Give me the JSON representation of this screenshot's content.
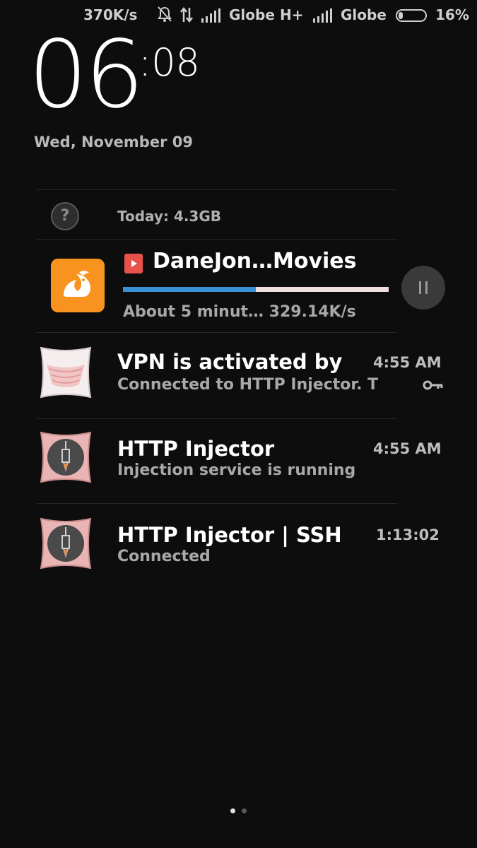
{
  "status_bar": {
    "speed": "370K/s",
    "carrier1_network": "",
    "carrier1": "Globe",
    "network_type": "H+",
    "carrier2": "Globe",
    "battery": "16%",
    "battery_level": 0.16,
    "icons": [
      "alarm-off-icon",
      "data-transfer-icon",
      "signal-icon",
      "signal-icon",
      "battery-icon"
    ]
  },
  "lockscreen": {
    "hour": "06",
    "minute": ":08",
    "date": "Wed, November 09"
  },
  "data_usage": {
    "label": "Today: 4.3GB",
    "icon": "help-icon"
  },
  "download": {
    "app_icon": "uc-browser-icon",
    "file_icon": "video-file-icon",
    "title": "DaneJon…Movies",
    "progress": 0.5,
    "status": "About 5 minut… 329.14K/s",
    "pause_icon": "pause-icon"
  },
  "notifications": [
    {
      "icon": "pillow-app-icon",
      "title": "VPN is activated by",
      "subtitle": "Connected to HTTP Injector. T",
      "time": "4:55 AM",
      "extra_icon": "key-icon"
    },
    {
      "icon": "http-injector-icon",
      "title": "HTTP Injector",
      "subtitle": "Injection service is running",
      "time": "4:55 AM"
    },
    {
      "icon": "http-injector-icon",
      "title": "HTTP Injector | SSH",
      "subtitle": "Connected",
      "time": "1:13:02"
    }
  ],
  "colors": {
    "background": "#0d0d0d",
    "accent_progress": "#3a8fd6",
    "uc_orange": "#f7931e"
  },
  "page_indicator": {
    "pages": 2,
    "active": 0
  }
}
